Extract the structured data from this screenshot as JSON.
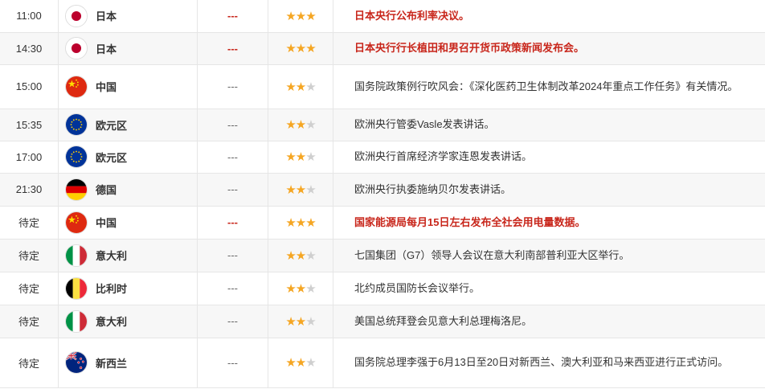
{
  "rows": [
    {
      "time": "11:00",
      "flag": "flag-japan-icon",
      "country": "日本",
      "previous": "---",
      "stars": 3,
      "event": "日本央行公布利率决议。",
      "highlight": true
    },
    {
      "time": "14:30",
      "flag": "flag-japan-icon",
      "country": "日本",
      "previous": "---",
      "stars": 3,
      "event": "日本央行行长植田和男召开货币政策新闻发布会。",
      "highlight": true
    },
    {
      "time": "15:00",
      "flag": "flag-china-icon",
      "country": "中国",
      "previous": "---",
      "stars": 2,
      "event": "国务院政策例行吹风会：《深化医药卫生体制改革2024年重点工作任务》有关情况。",
      "highlight": false
    },
    {
      "time": "15:35",
      "flag": "flag-eu-icon",
      "country": "欧元区",
      "previous": "---",
      "stars": 2,
      "event": "欧洲央行管委Vasle发表讲话。",
      "highlight": false
    },
    {
      "time": "17:00",
      "flag": "flag-eu-icon",
      "country": "欧元区",
      "previous": "---",
      "stars": 2,
      "event": "欧洲央行首席经济学家连恩发表讲话。",
      "highlight": false
    },
    {
      "time": "21:30",
      "flag": "flag-germany-icon",
      "country": "德国",
      "previous": "---",
      "stars": 2,
      "event": "欧洲央行执委施纳贝尔发表讲话。",
      "highlight": false
    },
    {
      "time": "待定",
      "flag": "flag-china-icon",
      "country": "中国",
      "previous": "---",
      "stars": 3,
      "event": "国家能源局每月15日左右发布全社会用电量数据。",
      "highlight": true
    },
    {
      "time": "待定",
      "flag": "flag-italy-icon",
      "country": "意大利",
      "previous": "---",
      "stars": 2,
      "event": "七国集团（G7）领导人会议在意大利南部普利亚大区举行。",
      "highlight": false
    },
    {
      "time": "待定",
      "flag": "flag-belgium-icon",
      "country": "比利时",
      "previous": "---",
      "stars": 2,
      "event": "北约成员国防长会议举行。",
      "highlight": false
    },
    {
      "time": "待定",
      "flag": "flag-italy-icon",
      "country": "意大利",
      "previous": "---",
      "stars": 2,
      "event": "美国总统拜登会见意大利总理梅洛尼。",
      "highlight": false
    },
    {
      "time": "待定",
      "flag": "flag-newzealand-icon",
      "country": "新西兰",
      "previous": "---",
      "stars": 2,
      "event": "国务院总理李强于6月13日至20日对新西兰、澳大利亚和马来西亚进行正式访问。",
      "highlight": false
    }
  ],
  "colors": {
    "highlight": "#c8261b",
    "star_on": "#f5a623",
    "star_off": "#cfcfcf"
  }
}
